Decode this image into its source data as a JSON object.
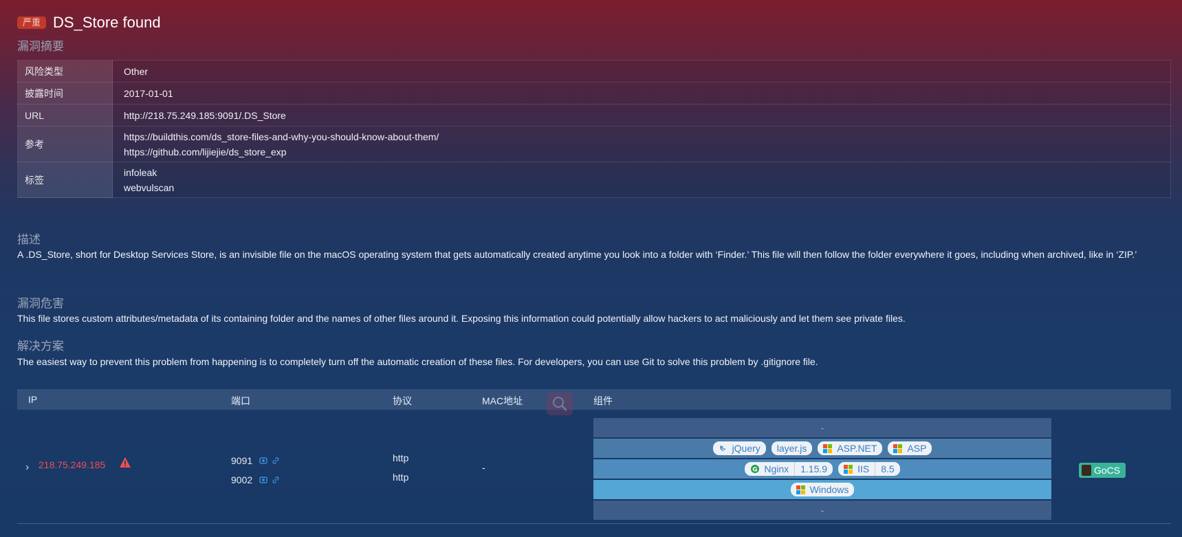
{
  "header": {
    "severity": "严重",
    "title": "DS_Store found"
  },
  "summary": {
    "heading": "漏洞摘要",
    "rows": [
      {
        "key": "风险类型",
        "values": [
          "Other"
        ]
      },
      {
        "key": "披露时间",
        "values": [
          "2017-01-01"
        ]
      },
      {
        "key": "URL",
        "values": [
          "http://218.75.249.185:9091/.DS_Store"
        ]
      },
      {
        "key": "参考",
        "values": [
          "https://buildthis.com/ds_store-files-and-why-you-should-know-about-them/",
          "https://github.com/lijiejie/ds_store_exp"
        ]
      },
      {
        "key": "标签",
        "values": [
          "infoleak",
          "webvulscan"
        ]
      }
    ]
  },
  "description": {
    "heading": "描述",
    "text": "A .DS_Store, short for Desktop Services Store, is an invisible file on the macOS operating system that gets automatically created anytime you look into a folder with ‘Finder.’ This file will then follow the folder everywhere it goes, including when archived, like in ‘ZIP.’"
  },
  "impact": {
    "heading": "漏洞危害",
    "text": "This file stores custom attributes/metadata of its containing folder and the names of other files around it. Exposing this information could potentially allow hackers to act maliciously and let them see private files."
  },
  "solution": {
    "heading": "解决方案",
    "text": "The easiest way to prevent this problem from happening is to completely turn off the automatic creation of these files. For developers, you can use Git to solve this problem by .gitignore file."
  },
  "hosts": {
    "columns": {
      "ip": "IP",
      "port": "端口",
      "protocol": "协议",
      "mac": "MAC地址",
      "components": "组件"
    },
    "row": {
      "ip": "218.75.249.185",
      "ports": [
        {
          "port": "9091",
          "protocol": "http"
        },
        {
          "port": "9002",
          "protocol": "http"
        }
      ],
      "mac": "-",
      "components": {
        "empty_top": "-",
        "row1": [
          "jQuery",
          "layer.js",
          "ASP.NET",
          "ASP"
        ],
        "row2": [
          {
            "name": "Nginx",
            "version": "1.15.9"
          },
          {
            "name": "IIS",
            "version": "8.5"
          }
        ],
        "row3": [
          "Windows"
        ],
        "empty_bottom": "-"
      },
      "poc": "GoCS"
    }
  },
  "colors": {
    "severity_bg": "#c0392b",
    "ip_red": "#f05050",
    "tag_text": "#3a7cc4",
    "gocs_green": "#38b39a"
  }
}
